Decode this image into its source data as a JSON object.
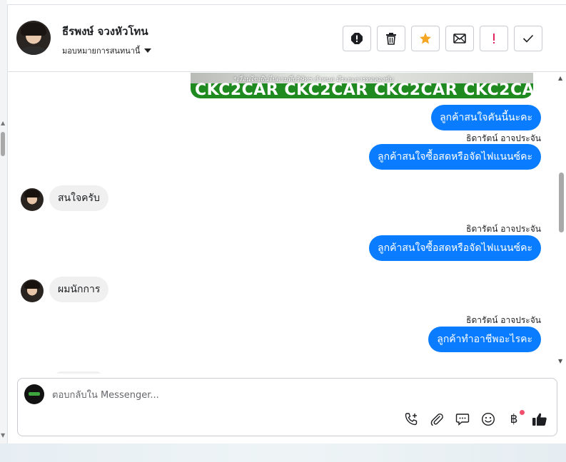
{
  "header": {
    "contact_name": "ธีรพงษ์ จวงหัวโทน",
    "assign_label": "มอบหมายการสนทนานี้",
    "actions": [
      "spam-icon",
      "trash-icon",
      "star-icon",
      "mail-icon",
      "important-icon",
      "check-icon"
    ],
    "colors": {
      "star": "#f5a623",
      "important": "#e0245e"
    }
  },
  "banner": {
    "small_text": "*เงื่อนไขเป็นไปตามที่บริษัทฯ กำหนด มีระยะการทดลองขับ",
    "big_text": "CKC2CAR CKC2CAR CKC2CAR CKC2CAR CKC2"
  },
  "messages": [
    {
      "dir": "out",
      "text": "ลูกค้าสนใจคันนี้นะคะ"
    },
    {
      "dir": "out",
      "sender": "ธิดารัตน์ อาจประจัน",
      "text": "ลูกค้าสนใจซื้อสดหรือจัดไฟแนนซ์คะ"
    },
    {
      "dir": "in",
      "text": "สนใจครับ"
    },
    {
      "dir": "out",
      "sender": "ธิดารัตน์ อาจประจัน",
      "text": "ลูกค้าสนใจซื้อสดหรือจัดไฟแนนซ์คะ"
    },
    {
      "dir": "in",
      "text": "ผมนักการ"
    },
    {
      "dir": "out",
      "sender": "ธิดารัตน์ อาจประจัน",
      "text": "ลูกค้าทำอาชีพอะไรคะ"
    }
  ],
  "composer": {
    "placeholder": "ตอบกลับใน Messenger...",
    "tools": [
      "call-add-icon",
      "attachment-icon",
      "saved-reply-icon",
      "emoji-icon",
      "payment-icon",
      "like-icon"
    ],
    "currency_symbol": "฿"
  },
  "theme": {
    "outgoing_bubble": "#0a7cff",
    "incoming_bubble": "#f0f0f0",
    "banner_green": "#1f8a1f"
  }
}
